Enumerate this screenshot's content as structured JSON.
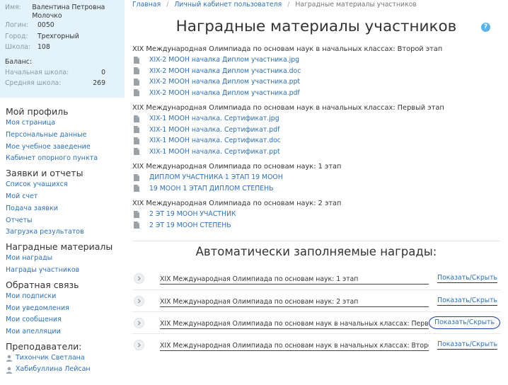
{
  "user": {
    "rows": [
      {
        "k": "Имя:",
        "v": "Валентина Петровна Молочко"
      },
      {
        "k": "Логин:",
        "v": "0050"
      },
      {
        "k": "Город:",
        "v": "Трехгорный"
      },
      {
        "k": "Школа:",
        "v": "108"
      }
    ],
    "balance_title": "Баланс:",
    "balance": [
      {
        "k": "Начальная школа:",
        "v": "0"
      },
      {
        "k": "Средняя школа:",
        "v": "269"
      }
    ]
  },
  "menu": [
    {
      "title": "Мой профиль",
      "items": [
        "Моя страница",
        "Персональные данные",
        "Мое учебное заведение",
        "Кабинет опорного пункта"
      ]
    },
    {
      "title": "Заявки и отчеты",
      "items": [
        "Список учащихся",
        "Мой счет",
        "Подача заявки",
        "Отчеты",
        "Загрузка результатов"
      ]
    },
    {
      "title": "Наградные материалы",
      "items": [
        "Мои награды",
        "Награды участников"
      ]
    },
    {
      "title": "Обратная связь",
      "items": [
        "Мои подписки",
        "Мои уведомления",
        "Мои сообщения",
        "Мои апелляции"
      ]
    },
    {
      "title": "Преподаватели:",
      "teachers": [
        "Тихончик Светлана",
        "Хабибуллина Лейсан"
      ]
    }
  ],
  "breadcrumb": [
    "Главная",
    "Личный кабинет пользователя",
    "Наградные материалы участников"
  ],
  "page_title": "Наградные материалы участников",
  "help": "?",
  "sections": [
    {
      "title": "XIX Международная Олимпиада по основам наук в начальных классах: Второй этап",
      "files": [
        "XIX-2 МООН началка Диплом участника.jpg",
        "XIX-2 МООН началка Диплом участника.doc",
        "XIX-2 МООН началка Диплом участника.ppt",
        "XIX-2 МООН началка Диплом участника.pdf"
      ]
    },
    {
      "title": "XIX Международная Олимпиада по основам наук в начальных классах: Первый этап",
      "files": [
        "XIX-1 МООН началка. Сертификат.jpg",
        "XIX-1 МООН началка. Сертификат.pdf",
        "XIX-1 МООН началка. Сертификат.doc",
        "XIX-1 МООН началка. Сертификат.ppt"
      ]
    },
    {
      "title": "XIX Международная Олимпиада по основам наук: 1 этап",
      "files": [
        "ДИПЛОМ УЧАСТНИКА 1 ЭТАП 19 МООН",
        "19 МООН 1 ЭТАП ДИПЛОМ СТЕПЕНЬ"
      ]
    },
    {
      "title": "XIX Международная Олимпиада по основам наук: 2 этап",
      "files": [
        "2 ЭТ 19 МООН УЧАСТНИК",
        "2 ЭТ 19 МООН СТЕПЕНЬ"
      ]
    }
  ],
  "auto_title": "Автоматически заполняемые награды:",
  "awards": [
    {
      "label": "XIX Международная Олимпиада по основам наук: 1 этап",
      "toggle": "Показать/Скрыть",
      "circled": false
    },
    {
      "label": "XIX Международная Олимпиада по основам наук: 2 этап",
      "toggle": "Показать/Скрыть",
      "circled": false
    },
    {
      "label": "XIX Международная Олимпиада по основам наук в начальных классах: Первый этап",
      "toggle": "Показать/Скрыть",
      "circled": true
    },
    {
      "label": "XIX Международная Олимпиада по основам наук в начальных классах: Второй этап",
      "toggle": "Показать/Скрыть",
      "circled": false
    }
  ]
}
